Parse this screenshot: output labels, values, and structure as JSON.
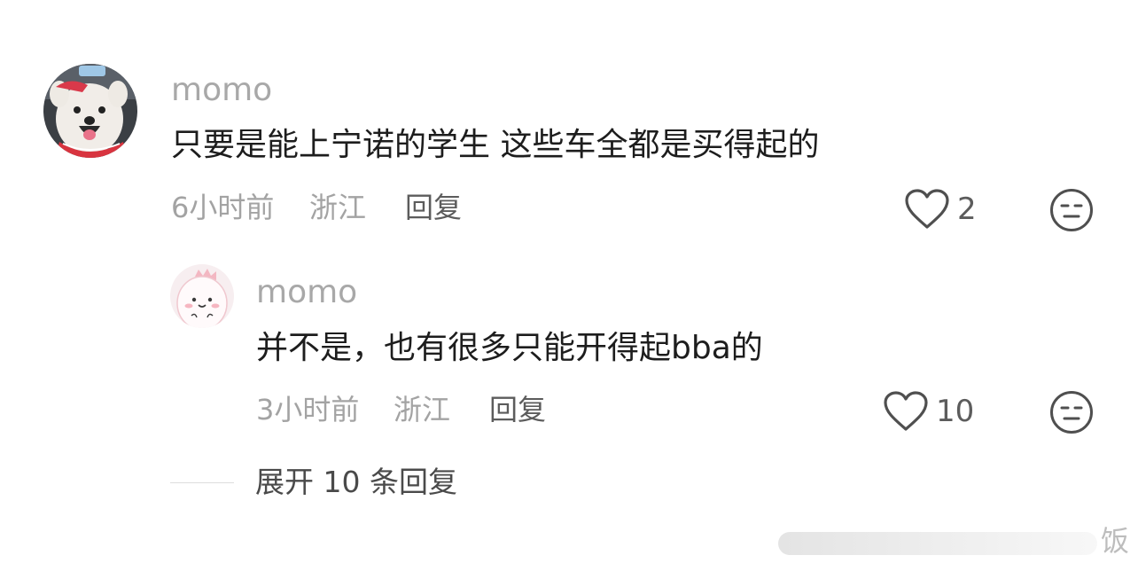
{
  "comment": {
    "username": "momo",
    "text": "只要是能上宁诺的学生 这些车全都是买得起的",
    "time": "6小时前",
    "location": "浙江",
    "reply_label": "回复",
    "likes": "2",
    "avatar_icon": "samoyed-dog-avatar",
    "like_icon": "heart-outline-icon",
    "dislike_icon": "meh-face-icon"
  },
  "reply": {
    "username": "momo",
    "text": "并不是，也有很多只能开得起bba的",
    "time": "3小时前",
    "location": "浙江",
    "reply_label": "回复",
    "likes": "10",
    "avatar_icon": "cartoon-dinosaur-avatar",
    "like_icon": "heart-outline-icon",
    "dislike_icon": "meh-face-icon"
  },
  "expand": {
    "label": "展开 10 条回复"
  },
  "watermark": {
    "char": "饭"
  },
  "colors": {
    "username": "#a8a8a8",
    "content": "#1d1d1d",
    "meta": "#a3a3a3",
    "action": "#5c5c5c"
  }
}
